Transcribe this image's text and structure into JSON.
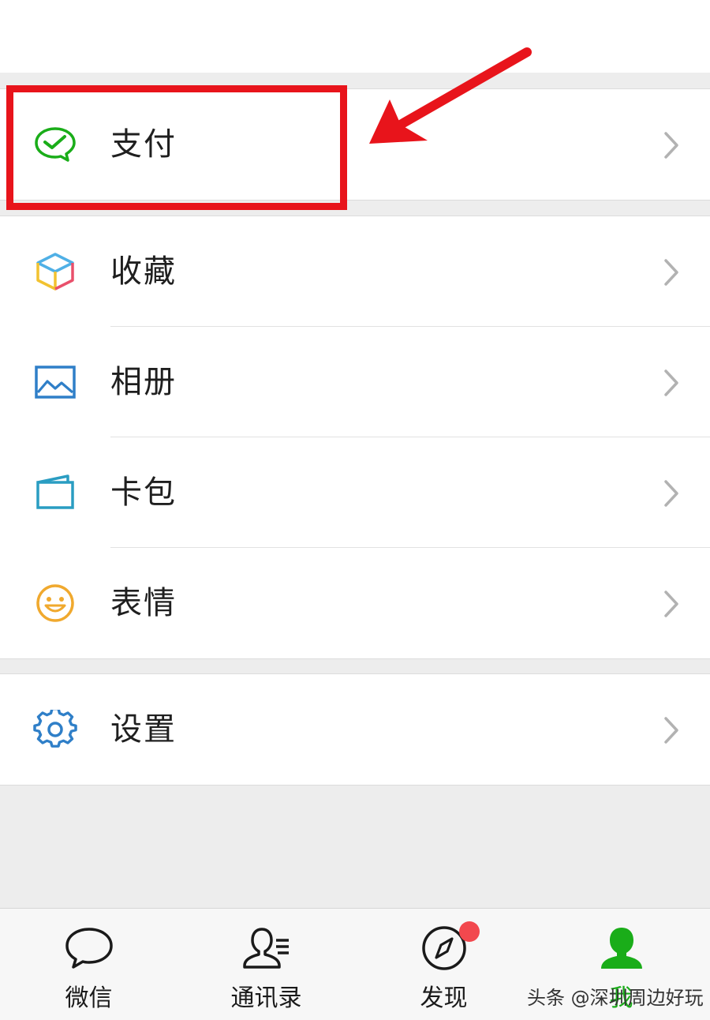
{
  "menu": {
    "pay": {
      "label": "支付",
      "icon": "wechat-pay-icon"
    },
    "favorites": {
      "label": "收藏",
      "icon": "cube-icon"
    },
    "album": {
      "label": "相册",
      "icon": "image-icon"
    },
    "cards": {
      "label": "卡包",
      "icon": "wallet-icon"
    },
    "stickers": {
      "label": "表情",
      "icon": "smiley-icon"
    },
    "settings": {
      "label": "设置",
      "icon": "gear-icon"
    }
  },
  "tabbar": {
    "tabs": [
      {
        "label": "微信",
        "icon": "chat-bubble-icon"
      },
      {
        "label": "通讯录",
        "icon": "contacts-icon"
      },
      {
        "label": "发现",
        "icon": "compass-icon"
      },
      {
        "label": "我",
        "icon": "person-icon",
        "active": true
      }
    ]
  },
  "watermark": "头条 @深圳周边好玩",
  "colors": {
    "accent_green": "#1aad19",
    "highlight_red": "#e8141b",
    "badge_red": "#f2484e",
    "background": "#ededed"
  }
}
